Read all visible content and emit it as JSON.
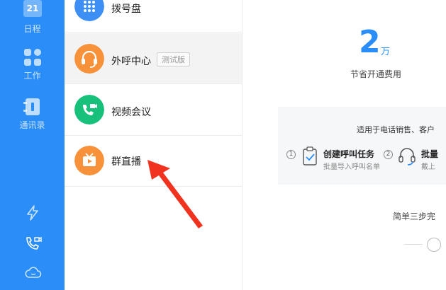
{
  "sidebar": {
    "calendar": {
      "date_number": "21",
      "label": "日程"
    },
    "work": {
      "label": "工作"
    },
    "contacts": {
      "label": "通讯录"
    },
    "bottom_icons": [
      "lightning-icon",
      "phone-video-icon",
      "cloud-icon"
    ]
  },
  "list": {
    "items": [
      {
        "label": "拨号盘",
        "icon": "dialpad-icon",
        "color": "#3d8ff5"
      },
      {
        "label": "外呼中心",
        "badge": "测试版",
        "icon": "headset-icon",
        "color": "#f7913a"
      },
      {
        "label": "视频会议",
        "icon": "video-call-icon",
        "color": "#17c17b"
      },
      {
        "label": "群直播",
        "icon": "tv-play-icon",
        "color": "#f7913a"
      }
    ]
  },
  "panel": {
    "savings_number": "2",
    "savings_unit": "万",
    "savings_caption": "节省开通费用",
    "card": {
      "title": "适用于电话销售、客户",
      "steps": [
        {
          "number": "1",
          "title": "创建呼叫任务",
          "subtitle": "批量导入呼叫名单",
          "icon": "clipboard-check-icon"
        },
        {
          "number": "2",
          "title": "批量",
          "subtitle": "戴上",
          "icon": "headset-icon"
        }
      ]
    },
    "simple_steps": "简单三步完"
  },
  "colors": {
    "sidebar_bg": "#2b8ef8",
    "accent": "#2b8ef8",
    "arrow": "#f0321e"
  }
}
